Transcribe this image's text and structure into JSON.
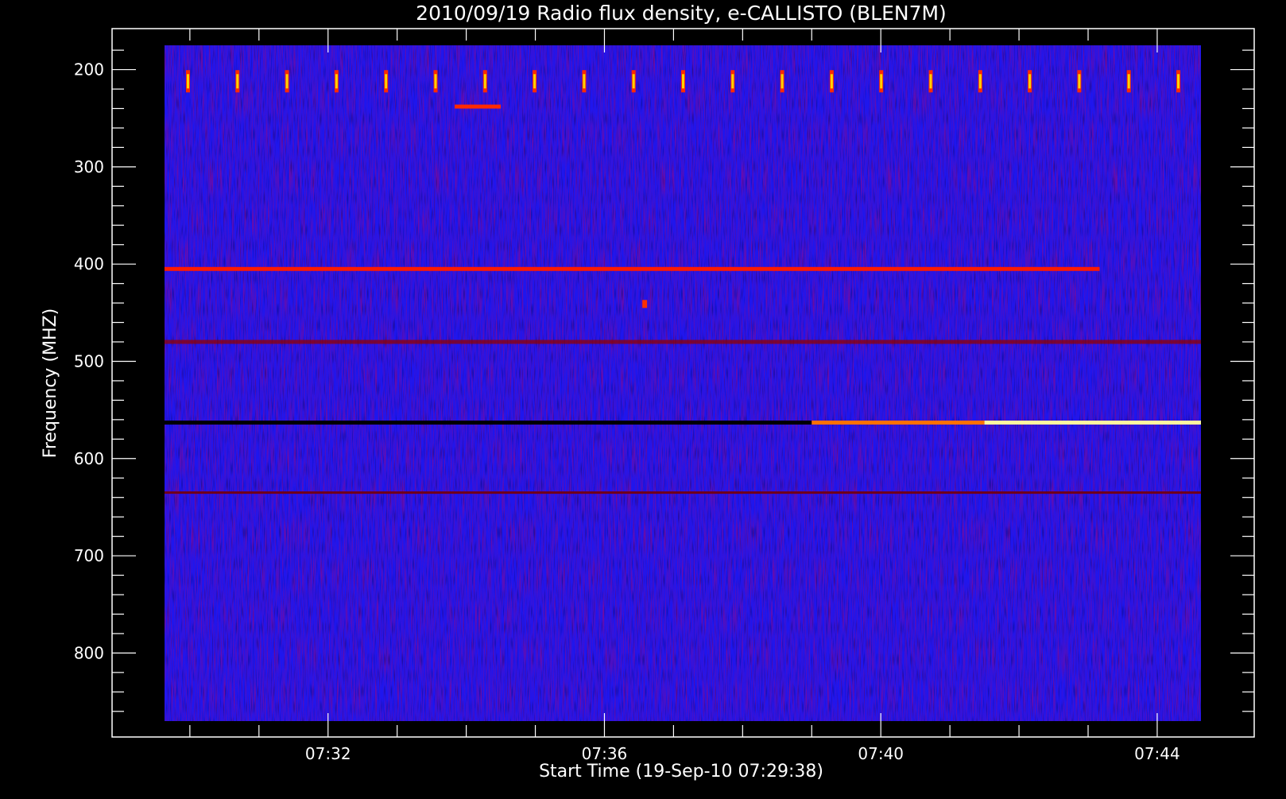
{
  "chart_data": {
    "type": "heatmap",
    "title": "2010/09/19  Radio flux density, e-CALLISTO (BLEN7M)",
    "xlabel": "Start Time (19-Sep-10 07:29:38)",
    "ylabel": "Frequency (MHZ)",
    "x_unit": "time (UT)",
    "x_range": [
      "07:29:38",
      "07:44:38"
    ],
    "y_range": [
      175,
      870
    ],
    "y_inverted": true,
    "x_ticks": [
      "07:32",
      "07:36",
      "07:40",
      "07:44"
    ],
    "y_ticks": [
      200,
      300,
      400,
      500,
      600,
      700,
      800
    ],
    "colorscale": [
      "#000000",
      "#1a00ff",
      "#c80000",
      "#ff6a00",
      "#ffd200",
      "#ffffff"
    ],
    "background_color": "#1e16ee",
    "features": [
      {
        "kind": "band",
        "freq_mhz": 212,
        "start": "07:29:38",
        "end": "07:44:38",
        "level": "periodic bright spikes",
        "color": "#ffd200"
      },
      {
        "kind": "band",
        "freq_mhz": 238,
        "start": "07:33:50",
        "end": "07:34:30",
        "level": "red",
        "color": "#ff2a00"
      },
      {
        "kind": "band",
        "freq_mhz": 405,
        "start": "07:29:38",
        "end": "07:43:10",
        "level": "red",
        "color": "#ff1a00"
      },
      {
        "kind": "band",
        "freq_mhz": 480,
        "start": "07:29:38",
        "end": "07:44:38",
        "level": "dark/red mixed",
        "color": "#900000"
      },
      {
        "kind": "band",
        "freq_mhz": 563,
        "start": "07:29:38",
        "end": "07:39:00",
        "level": "dark",
        "color": "#000000"
      },
      {
        "kind": "band",
        "freq_mhz": 563,
        "start": "07:39:00",
        "end": "07:41:30",
        "level": "orange",
        "color": "#ff7000"
      },
      {
        "kind": "band",
        "freq_mhz": 563,
        "start": "07:41:30",
        "end": "07:44:38",
        "level": "bright yellow-white",
        "color": "#fff4a0"
      },
      {
        "kind": "band",
        "freq_mhz": 635,
        "start": "07:29:38",
        "end": "07:44:38",
        "level": "dim red",
        "color": "#700018"
      },
      {
        "kind": "spot",
        "freq_mhz": 441,
        "time": "07:36:35",
        "level": "red",
        "color": "#ff3000"
      }
    ]
  }
}
